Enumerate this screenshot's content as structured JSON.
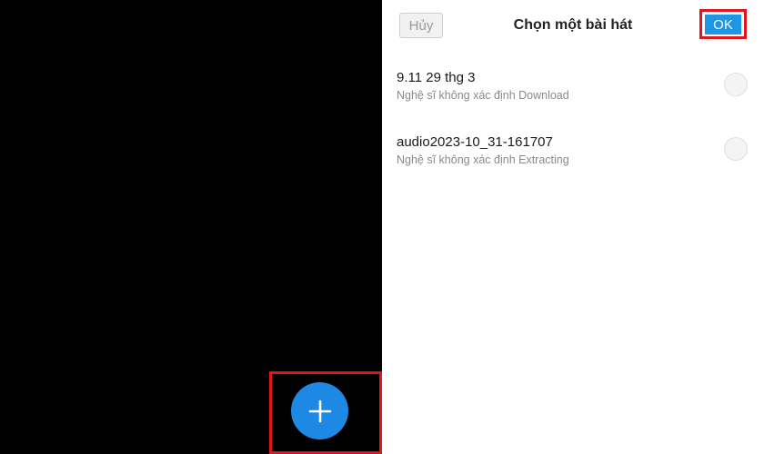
{
  "left_panel": {
    "add_button": {
      "icon": "plus-icon",
      "color": "#1e88e5"
    },
    "highlight_color": "#e0161e"
  },
  "song_picker": {
    "cancel_label": "Hủy",
    "title": "Chọn một bài hát",
    "ok_label": "OK",
    "ok_color": "#1e96e6",
    "songs": [
      {
        "title": "9.11 29 thg 3",
        "subtitle": "Nghệ sĩ không xác định Download",
        "selected": false
      },
      {
        "title": "audio2023-10_31-161707",
        "subtitle": "Nghệ sĩ không xác định Extracting",
        "selected": false
      }
    ]
  }
}
